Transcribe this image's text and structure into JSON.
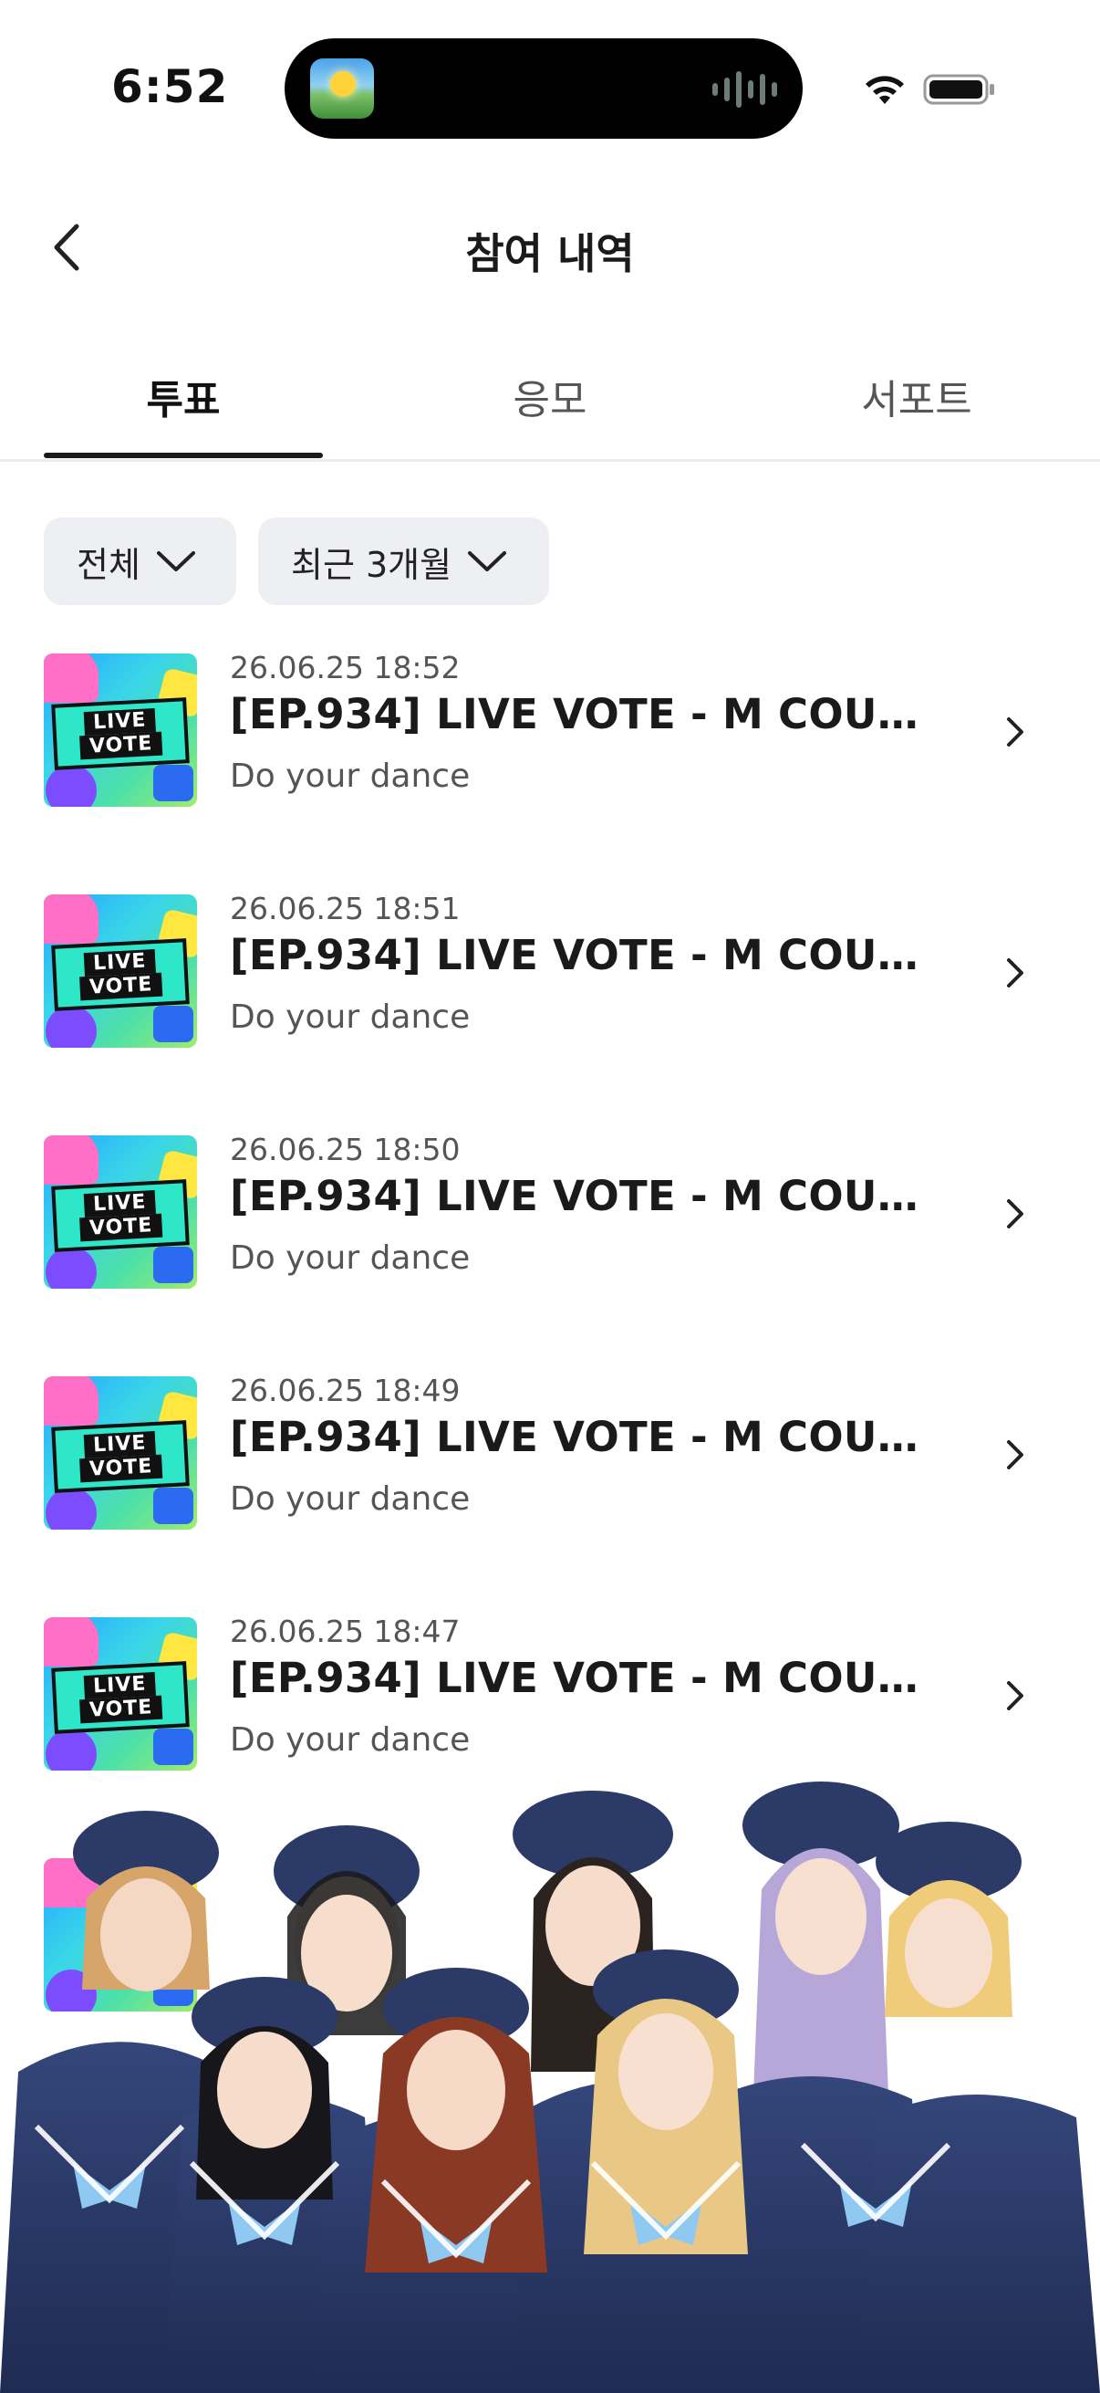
{
  "status_bar": {
    "time": "6:52"
  },
  "header": {
    "title": "참여 내역"
  },
  "tabs": [
    {
      "label": "투표",
      "active": true
    },
    {
      "label": "응모",
      "active": false
    },
    {
      "label": "서포트",
      "active": false
    }
  ],
  "filters": [
    {
      "label": "전체"
    },
    {
      "label": "최근 3개월"
    }
  ],
  "thumbnail": {
    "line1": "LIVE",
    "line2": "VOTE"
  },
  "history": [
    {
      "date": "26.06.25 18:52",
      "title": "[EP.934] LIVE VOTE - M COUNT...",
      "subtitle": "Do your dance"
    },
    {
      "date": "26.06.25 18:51",
      "title": "[EP.934] LIVE VOTE - M COUNT...",
      "subtitle": "Do your dance"
    },
    {
      "date": "26.06.25 18:50",
      "title": "[EP.934] LIVE VOTE - M COUNT...",
      "subtitle": "Do your dance"
    },
    {
      "date": "26.06.25 18:49",
      "title": "[EP.934] LIVE VOTE - M COUNT...",
      "subtitle": "Do your dance"
    },
    {
      "date": "26.06.25 18:47",
      "title": "[EP.934] LIVE VOTE - M COUNT...",
      "subtitle": "Do your dance"
    }
  ],
  "icons": {
    "back": "chevron-left-icon",
    "row_arrow": "chevron-right-icon",
    "filter_arrow": "chevron-down-icon",
    "wifi": "wifi-icon",
    "battery": "battery-icon"
  },
  "colors": {
    "filter_bg": "#eeeff2",
    "active_tab": "#1a1a1a",
    "promo_uniform": "#2b3a66"
  }
}
